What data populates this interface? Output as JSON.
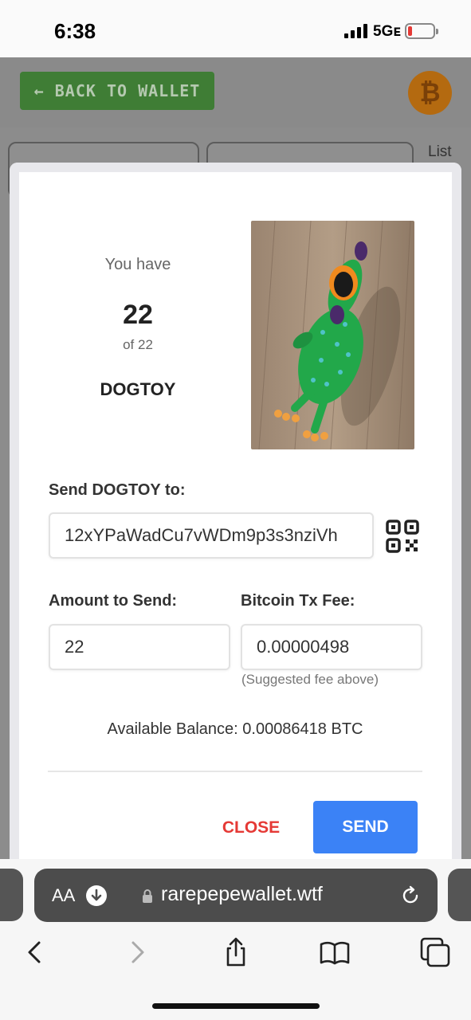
{
  "status_bar": {
    "time": "6:38",
    "network": "5Gᴇ"
  },
  "background_page": {
    "back_button_label": "← BACK TO WALLET",
    "currency_symbol": "₿",
    "list_label": "List"
  },
  "modal": {
    "you_have_label": "You have",
    "count": "22",
    "of_total": "of 22",
    "asset_name": "DOGTOY",
    "send_to_label": "Send DOGTOY to:",
    "address_value": "12xYPaWadCu7vWDm9p3s3nziVh",
    "amount_label": "Amount to Send:",
    "amount_value": "22",
    "fee_label": "Bitcoin Tx Fee:",
    "fee_value": "0.00000498",
    "fee_hint": "(Suggested fee above)",
    "balance_text": "Available Balance: 0.00086418 BTC",
    "close_label": "CLOSE",
    "send_label": "SEND"
  },
  "browser": {
    "text_size_label": "AA",
    "url": "rarepepewallet.wtf",
    "icons": [
      "download-icon",
      "lock-icon",
      "reload-icon",
      "back-icon",
      "forward-icon",
      "share-icon",
      "bookmarks-icon",
      "tabs-icon"
    ]
  },
  "colors": {
    "send_button": "#3b82f6",
    "close_text": "#e53935",
    "back_button": "#3f7d35",
    "bitcoin_logo": "#b46a10"
  }
}
